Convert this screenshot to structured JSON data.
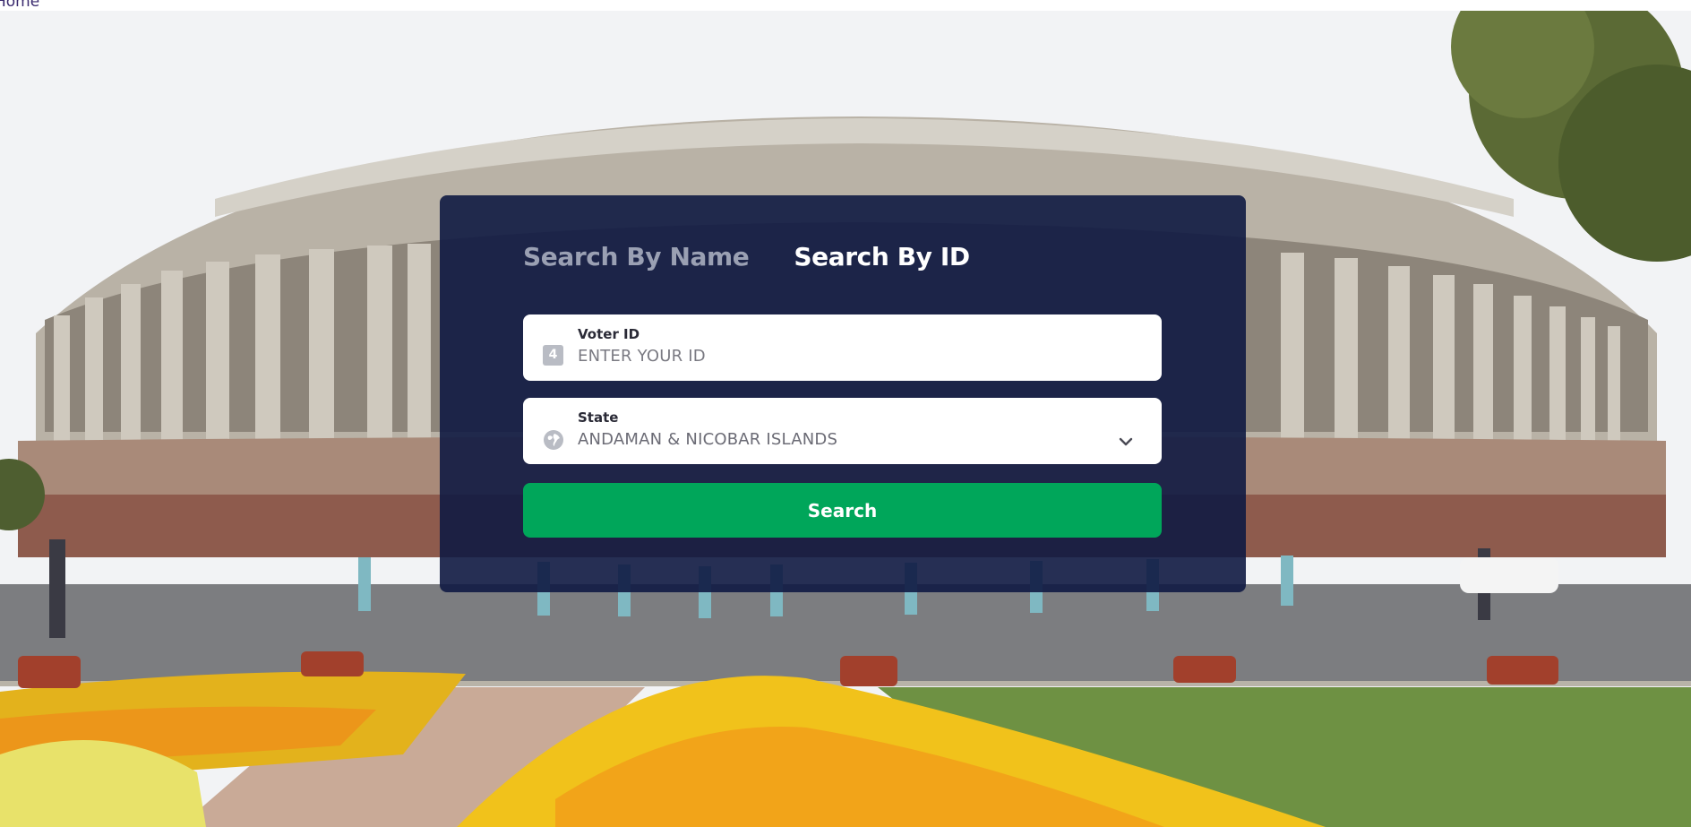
{
  "nav": {
    "home_label": "Home"
  },
  "search_card": {
    "tabs": [
      {
        "label": "Search By Name",
        "active": false
      },
      {
        "label": "Search By ID",
        "active": true
      }
    ],
    "voter_id": {
      "label": "Voter ID",
      "placeholder": "ENTER YOUR ID",
      "value": "",
      "icon": "id-card-icon"
    },
    "state": {
      "label": "State",
      "value": "ANDAMAN & NICOBAR ISLANDS",
      "icon": "globe-icon"
    },
    "search_button_label": "Search"
  },
  "colors": {
    "card_background": "#101a42",
    "search_button": "#00a65a",
    "active_tab_text": "#ffffff",
    "inactive_tab_text": "#9aa0b3"
  }
}
